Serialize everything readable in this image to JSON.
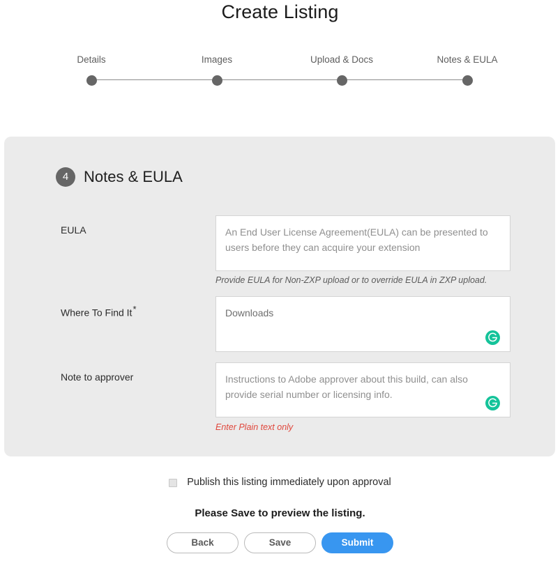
{
  "page": {
    "title": "Create Listing"
  },
  "stepper": {
    "steps": [
      {
        "label": "Details"
      },
      {
        "label": "Images"
      },
      {
        "label": "Upload & Docs"
      },
      {
        "label": "Notes & EULA"
      }
    ]
  },
  "section": {
    "number": "4",
    "title": "Notes & EULA"
  },
  "fields": {
    "eula": {
      "label": "EULA",
      "placeholder": "An End User License Agreement(EULA) can be presented to users before they can acquire your extension",
      "value": "",
      "helper": "Provide EULA for Non-ZXP upload or to override EULA in ZXP upload."
    },
    "where_to_find_it": {
      "label": "Where To Find It",
      "required_marker": "*",
      "placeholder": "Downloads",
      "value": "",
      "badge_icon": "grammarly-icon"
    },
    "note_to_approver": {
      "label": "Note to approver",
      "placeholder": "Instructions to Adobe approver about this build, can also provide serial number or licensing info.",
      "value": "",
      "helper": "Enter Plain text only",
      "badge_icon": "grammarly-icon"
    }
  },
  "publish": {
    "label": "Publish this listing immediately upon approval",
    "checked": false
  },
  "save_hint": "Please Save to preview the listing.",
  "buttons": {
    "back": "Back",
    "save": "Save",
    "submit": "Submit"
  },
  "colors": {
    "panel_bg": "#ebebeb",
    "submit_blue": "#3896f0",
    "badge_green": "#15c39a",
    "error_red": "#e0473c",
    "step_dot": "#666666"
  }
}
